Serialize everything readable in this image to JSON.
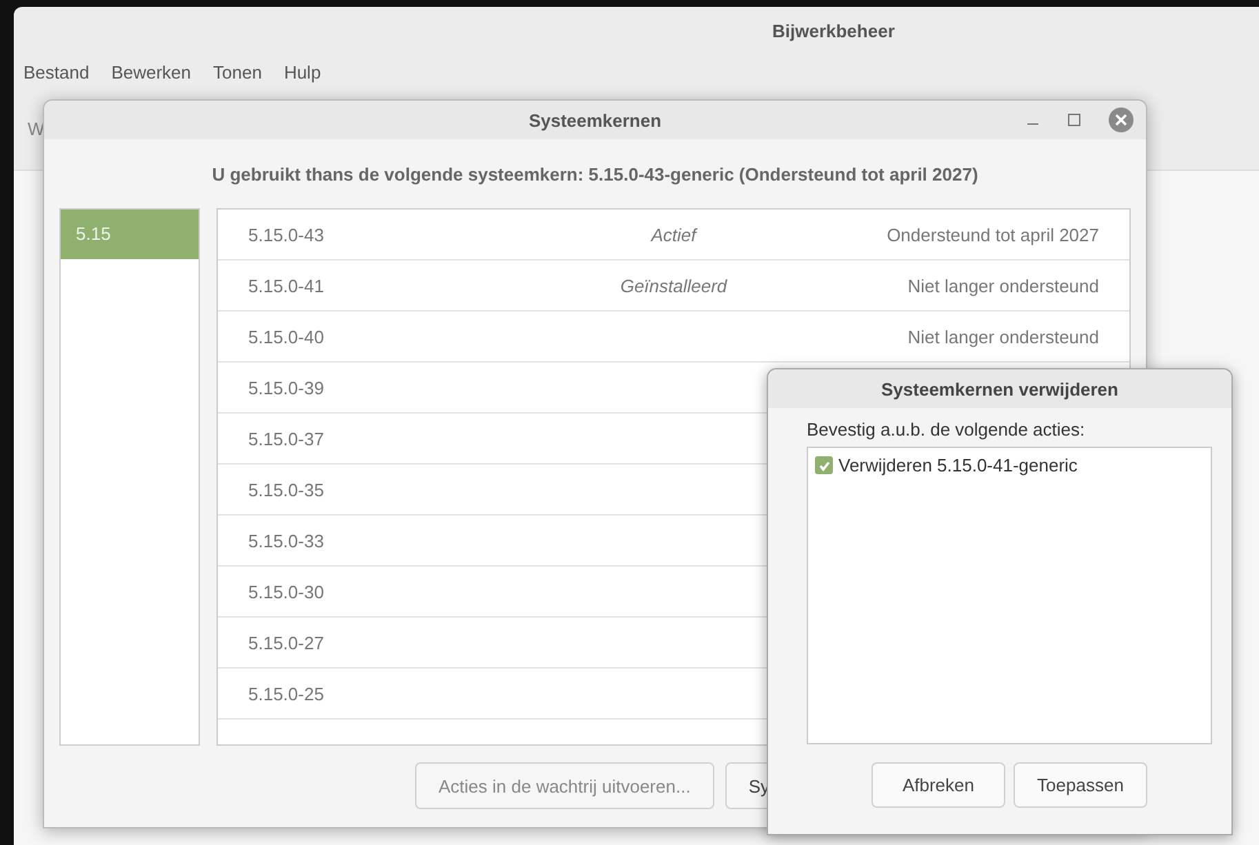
{
  "main_window": {
    "title": "Bijwerkbeheer",
    "menu": [
      "Bestand",
      "Bewerken",
      "Tonen",
      "Hulp"
    ],
    "toolbar_item": "W"
  },
  "kernels_dialog": {
    "title": "Systeemkernen",
    "heading": "U gebruikt thans de volgende systeemkern: 5.15.0-43-generic (Ondersteund tot april 2027)",
    "series": [
      {
        "label": "5.15",
        "selected": true
      }
    ],
    "kernels": [
      {
        "version": "5.15.0-43",
        "status": "Actief",
        "support": "Ondersteund tot april 2027"
      },
      {
        "version": "5.15.0-41",
        "status": "Geïnstalleerd",
        "support": "Niet langer ondersteund"
      },
      {
        "version": "5.15.0-40",
        "support": "Niet langer ondersteund"
      },
      {
        "version": "5.15.0-39"
      },
      {
        "version": "5.15.0-37"
      },
      {
        "version": "5.15.0-35"
      },
      {
        "version": "5.15.0-33"
      },
      {
        "version": "5.15.0-30"
      },
      {
        "version": "5.15.0-27"
      },
      {
        "version": "5.15.0-25"
      }
    ],
    "buttons": [
      "Acties in de wachtrij uitvoeren...",
      "Sy"
    ]
  },
  "remove_dialog": {
    "title": "Systeemkernen verwijderen",
    "prompt": "Bevestig a.u.b. de volgende acties:",
    "actions": [
      {
        "label": "Verwijderen 5.15.0-41-generic",
        "checked": true
      }
    ],
    "buttons": [
      "Afbreken",
      "Toepassen"
    ]
  }
}
